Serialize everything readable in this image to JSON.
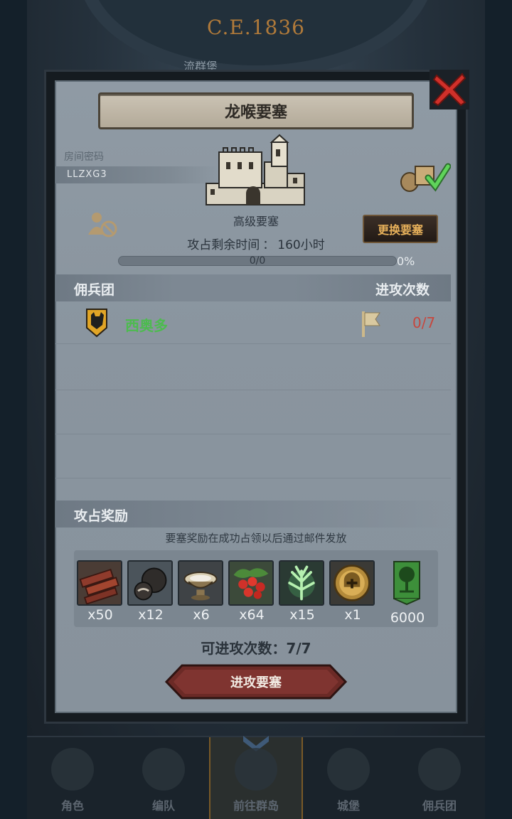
{
  "background": {
    "era_label": "C.E.1836",
    "location_label": "流群堡"
  },
  "dialog": {
    "title": "龙喉要塞",
    "room": {
      "label": "房间密码",
      "code": "LLZXG3"
    },
    "fortress_type": "高级要塞",
    "change_button_label": "更换要塞",
    "time_remaining": {
      "label": "攻占剩余时间",
      "separator": "：",
      "value": "160小时"
    },
    "progress": {
      "text": "0/0",
      "percent_label": "0%",
      "fraction": 0
    },
    "mercenary_section": {
      "title": "佣兵团",
      "attacks_header": "进攻次数",
      "rows": [
        {
          "name": "西奥多",
          "attacks": "0/7"
        }
      ]
    },
    "reward_section": {
      "title": "攻占奖励",
      "note": "要塞奖励在成功占领以后通过邮件发放",
      "items": [
        {
          "icon": "wood-logs-icon",
          "qty": "x50"
        },
        {
          "icon": "truffle-icon",
          "qty": "x12"
        },
        {
          "icon": "bowl-icon",
          "qty": "x6"
        },
        {
          "icon": "berries-icon",
          "qty": "x64"
        },
        {
          "icon": "herb-icon",
          "qty": "x15"
        },
        {
          "icon": "helmet-medal-icon",
          "qty": "x1"
        },
        {
          "icon": "tree-banner-icon",
          "qty": "6000"
        }
      ]
    },
    "attacks_available": {
      "label": "可进攻次数",
      "separator": "：",
      "value": "7/7"
    },
    "attack_button_label": "进攻要塞"
  },
  "bottom_nav": [
    {
      "label": "角色",
      "active": false
    },
    {
      "label": "编队",
      "active": false
    },
    {
      "label": "前往群岛",
      "active": true
    },
    {
      "label": "城堡",
      "active": false
    },
    {
      "label": "佣兵团",
      "active": false
    }
  ],
  "colors": {
    "accent_gold": "#e6b05a",
    "merc_name_green": "#4dbb4f",
    "attack_count_red": "#c6473e",
    "close_red": "#d0302a"
  }
}
